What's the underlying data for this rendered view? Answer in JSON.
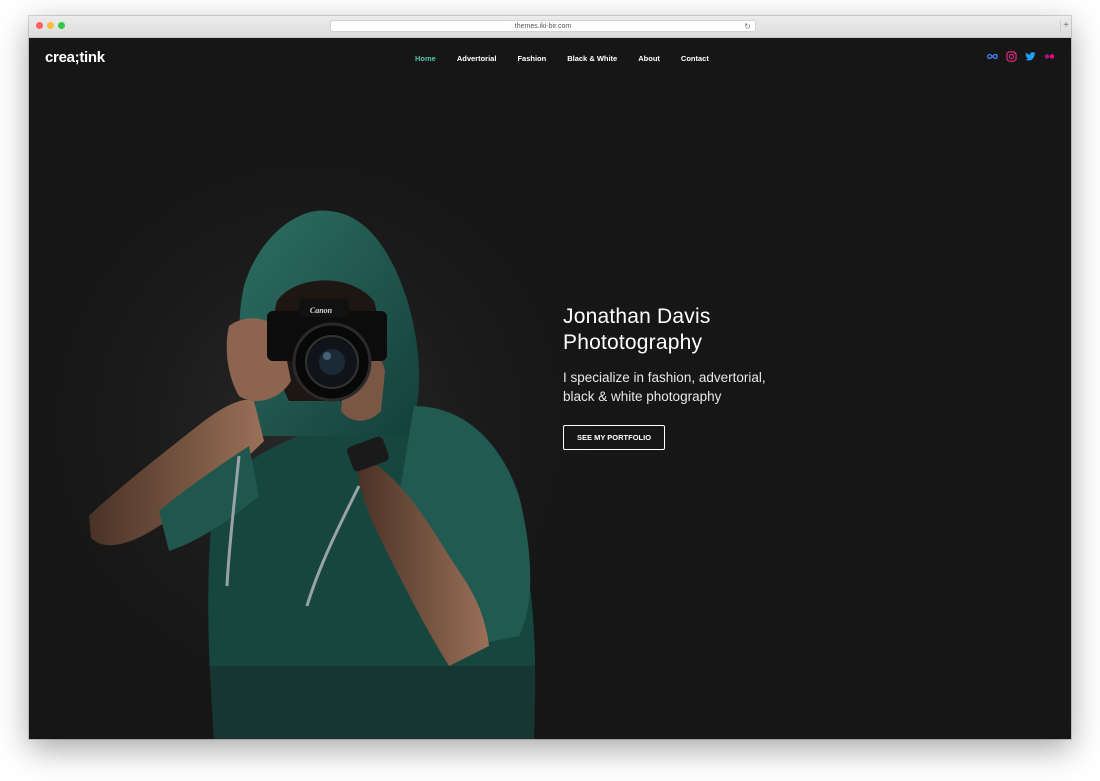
{
  "browser": {
    "url": "themes.iki-bir.com",
    "reload_icon": "reload-icon",
    "newtab_icon": "plus-icon"
  },
  "header": {
    "logo": "crea;tink",
    "nav": [
      {
        "label": "Home",
        "active": true
      },
      {
        "label": "Advertorial",
        "active": false
      },
      {
        "label": "Fashion",
        "active": false
      },
      {
        "label": "Black & White",
        "active": false
      },
      {
        "label": "About",
        "active": false
      },
      {
        "label": "Contact",
        "active": false
      }
    ],
    "social": [
      {
        "name": "infinity-icon",
        "color": "#3b82f6"
      },
      {
        "name": "instagram-icon",
        "color": "#d62976"
      },
      {
        "name": "twitter-icon",
        "color": "#1da1f2"
      },
      {
        "name": "flickr-icon",
        "color": "#ff0084"
      }
    ]
  },
  "hero": {
    "title_line1": "Jonathan Davis",
    "title_line2": "Phototography",
    "subtitle_line1": "I specialize in fashion, advertorial,",
    "subtitle_line2": "black & white photography",
    "cta_label": "SEE MY PORTFOLIO"
  },
  "colors": {
    "background": "#161616",
    "accent": "#4fc4a6",
    "hoodie": "#1f5a52"
  }
}
